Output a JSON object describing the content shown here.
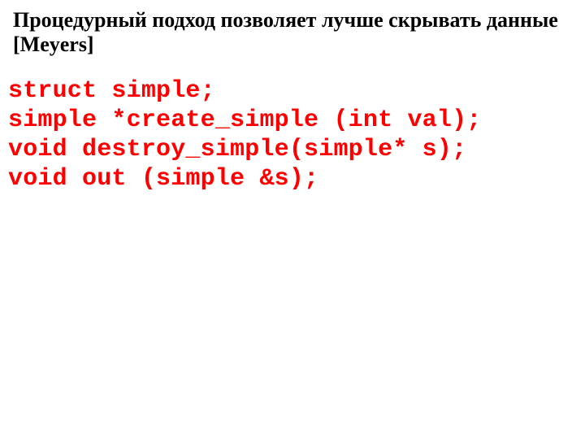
{
  "title": "Процедурный подход позволяет лучше скрывать данные [Meyers]",
  "code": {
    "line1": "struct simple;",
    "line2": "simple *create_simple (int val);",
    "line3": "void destroy_simple(simple* s);",
    "line4": "void out (simple &s);"
  }
}
